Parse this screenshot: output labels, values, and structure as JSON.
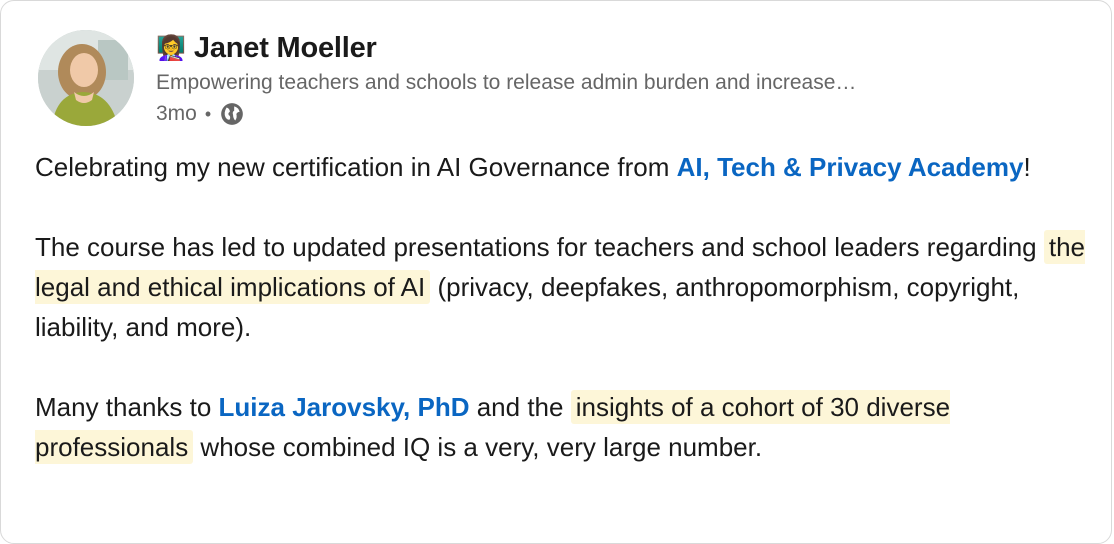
{
  "author": {
    "emoji": "👩‍🏫",
    "name": "Janet Moeller",
    "headline": "Empowering teachers and schools to release admin burden and increase…",
    "time": "3mo",
    "separator": "•",
    "visibility_icon": "globe-icon"
  },
  "post": {
    "p1": {
      "t1": "Celebrating my new certification in AI Governance from ",
      "mention1": "AI, Tech & Privacy Academy",
      "t2": "!"
    },
    "p2": {
      "t1": "The course has led to updated presentations for teachers and school leaders regarding ",
      "highlight1": "the legal and ethical implications of AI",
      "t2": " (privacy, deepfakes, anthropomorphism, copyright, liability, and more)."
    },
    "p3": {
      "t1": "Many thanks to ",
      "mention1": "Luiza Jarovsky, PhD",
      "t2": " and the ",
      "highlight1": "insights of a cohort of 30 diverse professionals",
      "t3": " whose combined IQ is a very, very large number."
    }
  },
  "colors": {
    "mention": "#0a66c2",
    "highlight": "#fdf6d8",
    "text": "#1a1a1a",
    "secondary": "#666666"
  }
}
